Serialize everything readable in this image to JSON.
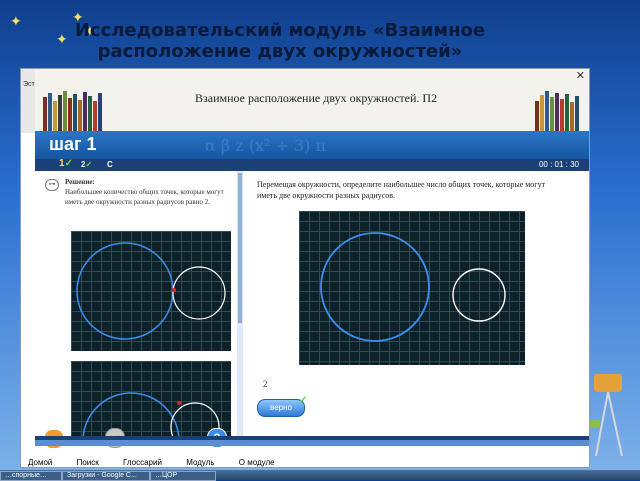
{
  "slide": {
    "title_line1": "Исследовательский модуль «Взаимное",
    "title_line2": "расположение двух окружностей»"
  },
  "window": {
    "title": "Взаимное расположение двух окружностей. П2",
    "close_label": "✕",
    "left_strip_label": "Эст"
  },
  "step": {
    "label_word": "шаг",
    "label_number": "1",
    "step1": "1",
    "step1_check": "✓",
    "step2": "2",
    "step2_check": "✓",
    "step3": "С",
    "timer": "00 : 01 : 30"
  },
  "solution": {
    "heading": "Решение:",
    "text": "Наибольшее количество общих точек, которые могут иметь две окружности разных радиусов равно 2."
  },
  "task": {
    "text": "Перемещая окружности, определите наибольшее число общих точек, которые могут иметь две окружности разных радиусов.",
    "answer": "2",
    "verify_label": "верно",
    "verify_check": "✓"
  },
  "buttons": {
    "help": "?",
    "key": "⊶"
  },
  "menu": {
    "items": [
      "Домой",
      "Поиск",
      "Глоссарий",
      "Модуль",
      "О модуле"
    ]
  },
  "taskbar": {
    "items": [
      "…спорные…",
      "Загрузки - Google C...",
      "…ЦОР"
    ]
  },
  "colors": {
    "grid_bg": "#0e2128",
    "circle_blue": "#3d8ef0",
    "circle_white": "#ffffff",
    "intersection": "#e02020",
    "header_blue": "#15569f"
  }
}
